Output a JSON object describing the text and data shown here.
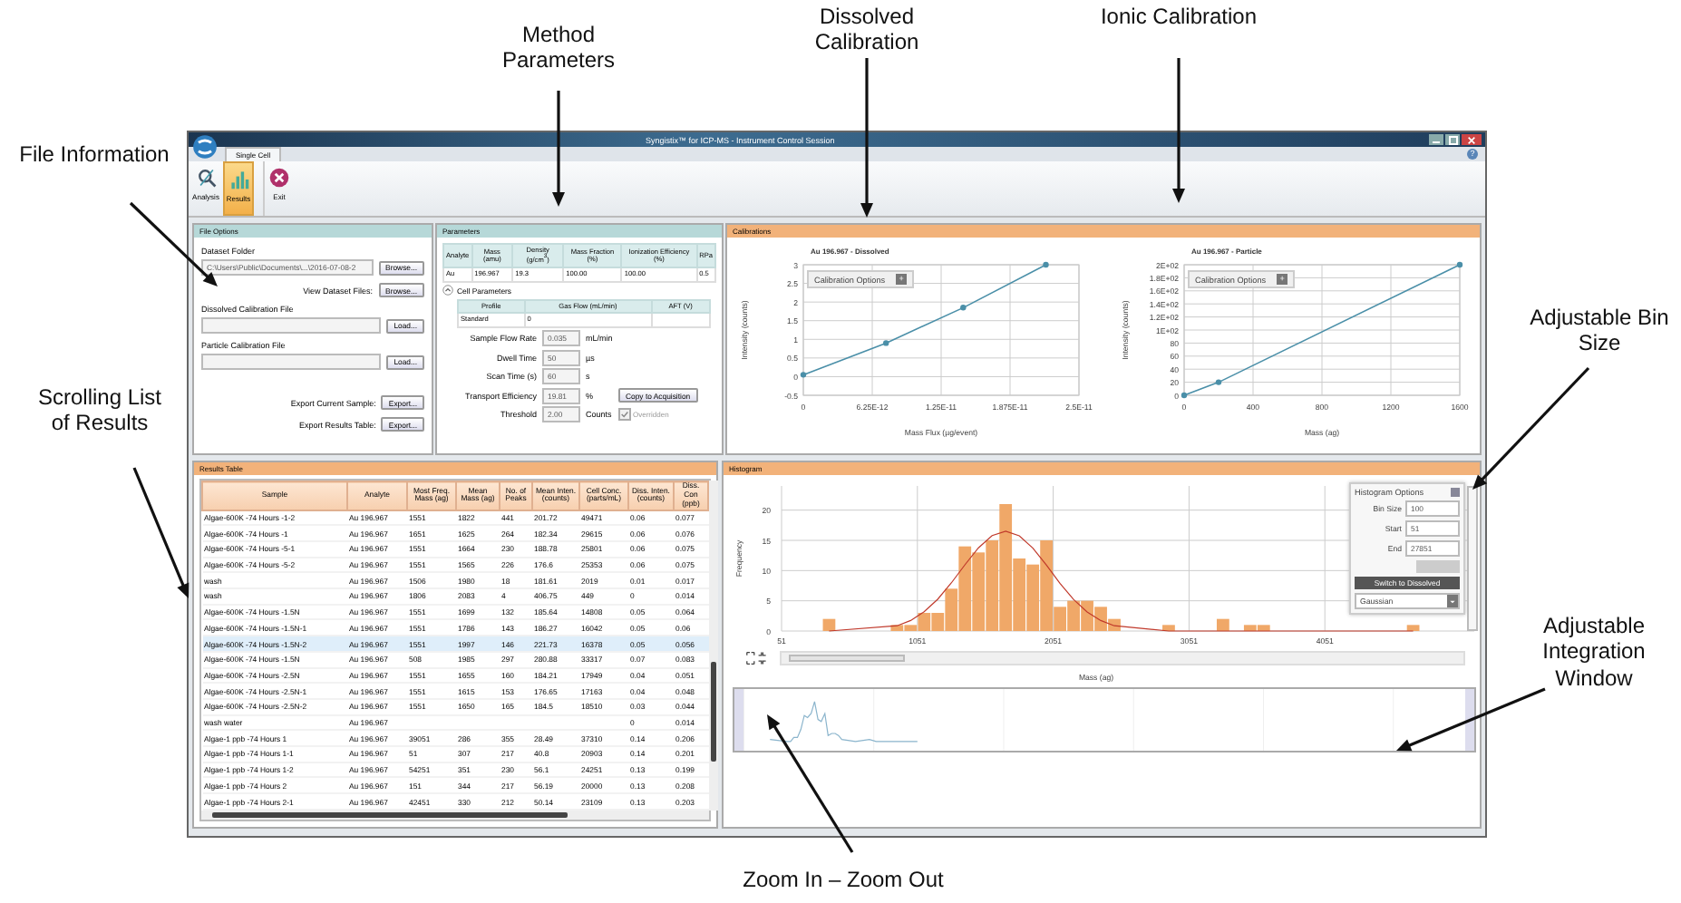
{
  "callouts": [
    {
      "text": "Method Parameters"
    },
    {
      "text": "Dissolved Calibration"
    },
    {
      "text": "Ionic Calibration"
    },
    {
      "text": "File Information"
    },
    {
      "text": "Scrolling List of Results"
    },
    {
      "text": "Adjustable Bin Size"
    },
    {
      "text": "Adjustable Integration Window"
    },
    {
      "text": "Zoom In – Zoom Out"
    }
  ],
  "window": {
    "title": "Syngistix™ for ICP-MS - Instrument Control Session",
    "help": "?"
  },
  "ribbon": {
    "tab": "Single Cell",
    "buttons": [
      {
        "label": "Analysis",
        "kind": "analysis",
        "selected": false
      },
      {
        "label": "Results",
        "kind": "results",
        "selected": true
      },
      {
        "label": "Exit",
        "kind": "exit",
        "selected": false
      }
    ]
  },
  "file_options": {
    "title": "File Options",
    "rows": [
      {
        "kind": "folder",
        "label": "Dataset Folder",
        "value": "C:\\Users\\Public\\Documents\\...\\2016-07-08-2",
        "button": "Browse..."
      },
      {
        "kind": "action",
        "label": "View Dataset Files:",
        "button": "Browse..."
      },
      {
        "kind": "file",
        "label": "Dissolved Calibration File",
        "button": "Load..."
      },
      {
        "kind": "file",
        "label": "Particle Calibration File",
        "button": "Load..."
      },
      {
        "kind": "action",
        "label": "Export Current Sample:",
        "button": "Export..."
      },
      {
        "kind": "action",
        "label": "Export Results Table:",
        "button": "Export..."
      }
    ]
  },
  "parameters": {
    "title": "Parameters",
    "analyte_table": {
      "columns": [
        "Analyte",
        "Mass (amu)",
        "Density (g/cm$^{3}$)",
        "Mass Fraction (%)",
        "Ionization Efficiency (%)",
        "RPa"
      ],
      "rows": [
        [
          "Au",
          "196.967",
          "19.3",
          "100.00",
          "100.00",
          "0.5"
        ]
      ]
    },
    "cell_parameters": {
      "label": "Cell Parameters",
      "expanded": true,
      "columns": [
        "Profile",
        "Gas Flow (mL/min)",
        "AFT (V)"
      ],
      "rows": [
        [
          "Standard",
          "0",
          null
        ]
      ]
    },
    "rows": [
      {
        "kind": "field",
        "label": "Sample Flow Rate",
        "value": "0.035",
        "unit": "mL/min"
      },
      {
        "kind": "field",
        "label": "Dwell Time",
        "value": "50",
        "unit": "µs"
      },
      {
        "kind": "field",
        "label": "Scan Time (s)",
        "value": "60",
        "unit": "s"
      },
      {
        "kind": "button",
        "label": "Transport Efficiency",
        "value": "19.81",
        "unit": "%",
        "button": "Copy to Acquisition"
      },
      {
        "kind": "checkbox",
        "label": "Threshold",
        "value": "2.00",
        "unit": "Counts",
        "checkbox": {
          "label": "Overridden",
          "checked": true
        }
      }
    ]
  },
  "calibrations": {
    "title": "Calibrations",
    "charts": [
      {
        "options_label": "Calibration Options",
        "options_button": "+",
        "chart_data": {
          "type": "line",
          "title": "Au 196.967 - Dissolved",
          "xlabel": "Mass Flux (µg/event)",
          "ylabel": "Intensity (counts)",
          "x": [
            0,
            7.5e-12,
            1.45e-11,
            2.2e-11
          ],
          "grid": true,
          "series": [
            {
              "color": "#4a8fa8",
              "marker": true,
              "values": [
                0.05,
                0.9,
                1.85,
                3
              ]
            }
          ],
          "xlim": [
            0,
            2.5e-11
          ],
          "ylim": [
            -0.5,
            3
          ],
          "xticks": [
            {
              "value": 0,
              "label": "0"
            },
            {
              "value": 6.25e-12,
              "label": "6.25E-12"
            },
            {
              "value": 1.25e-11,
              "label": "1.25E-11"
            },
            {
              "value": 1.875e-11,
              "label": "1.875E-11"
            },
            {
              "value": 2.5e-11,
              "label": "2.5E-11"
            }
          ],
          "yticks": [
            -0.5,
            0,
            0.5,
            1,
            1.5,
            2,
            2.5,
            3
          ]
        }
      },
      {
        "options_label": "Calibration Options",
        "options_button": "+",
        "chart_data": {
          "type": "line",
          "title": "Au 196.967 - Particle",
          "xlabel": "Mass (ag)",
          "ylabel": "Intensity (counts)",
          "x": [
            0,
            200,
            1600
          ],
          "grid": true,
          "series": [
            {
              "color": "#4a8fa8",
              "marker": true,
              "values": [
                0,
                20,
                200
              ]
            }
          ],
          "xlim": [
            0,
            1600
          ],
          "ylim": [
            0,
            200
          ],
          "xticks": [
            0,
            400,
            800,
            1200,
            1600
          ],
          "yticks": [
            0,
            20,
            40,
            60,
            80,
            {
              "value": 100,
              "label": "1E+02"
            },
            {
              "value": 120,
              "label": "1.2E+02"
            },
            {
              "value": 140,
              "label": "1.4E+02"
            },
            {
              "value": 160,
              "label": "1.6E+02"
            },
            {
              "value": 180,
              "label": "1.8E+02"
            },
            {
              "value": 200,
              "label": "2E+02"
            }
          ]
        }
      }
    ]
  },
  "results_table": {
    "title": "Results Table",
    "columns": [
      "Sample",
      "Analyte",
      "Most Freq. Mass (ag)",
      "Mean Mass (ag)",
      "No. of Peaks",
      "Mean Inten. (counts)",
      "Cell Conc. (parts/mL)",
      "Diss. Inten. (counts)",
      "Diss. Con (ppb)"
    ],
    "rows": [
      {
        "selected": false,
        "cells": [
          "Algae-600K -74 Hours -1-2",
          "Au 196.967",
          "1551",
          "1822",
          "441",
          "201.72",
          "49471",
          "0.06",
          "0.077"
        ]
      },
      {
        "selected": false,
        "cells": [
          "Algae-600K -74 Hours -1",
          "Au 196.967",
          "1651",
          "1625",
          "264",
          "182.34",
          "29615",
          "0.06",
          "0.076"
        ]
      },
      {
        "selected": false,
        "cells": [
          "Algae-600K -74 Hours -5-1",
          "Au 196.967",
          "1551",
          "1664",
          "230",
          "188.78",
          "25801",
          "0.06",
          "0.075"
        ]
      },
      {
        "selected": false,
        "cells": [
          "Algae-600K -74 Hours -5-2",
          "Au 196.967",
          "1551",
          "1565",
          "226",
          "176.6",
          "25353",
          "0.06",
          "0.075"
        ]
      },
      {
        "selected": false,
        "cells": [
          "wash",
          "Au 196.967",
          "1506",
          "1980",
          "18",
          "181.61",
          "2019",
          "0.01",
          "0.017"
        ]
      },
      {
        "selected": false,
        "cells": [
          "wash",
          "Au 196.967",
          "1806",
          "2083",
          "4",
          "406.75",
          "449",
          "0",
          "0.014"
        ]
      },
      {
        "selected": false,
        "cells": [
          "Algae-600K -74 Hours -1.5N",
          "Au 196.967",
          "1551",
          "1699",
          "132",
          "185.64",
          "14808",
          "0.05",
          "0.064"
        ]
      },
      {
        "selected": false,
        "cells": [
          "Algae-600K -74 Hours -1.5N-1",
          "Au 196.967",
          "1551",
          "1786",
          "143",
          "186.27",
          "16042",
          "0.05",
          "0.06"
        ]
      },
      {
        "selected": true,
        "cells": [
          "Algae-600K -74 Hours -1.5N-2",
          "Au 196.967",
          "1551",
          "1997",
          "146",
          "221.73",
          "16378",
          "0.05",
          "0.056"
        ]
      },
      {
        "selected": false,
        "cells": [
          "Algae-600K -74 Hours -1.5N",
          "Au 196.967",
          "508",
          "1985",
          "297",
          "280.88",
          "33317",
          "0.07",
          "0.083"
        ]
      },
      {
        "selected": false,
        "cells": [
          "Algae-600K -74 Hours -2.5N",
          "Au 196.967",
          "1551",
          "1655",
          "160",
          "184.21",
          "17949",
          "0.04",
          "0.051"
        ]
      },
      {
        "selected": false,
        "cells": [
          "Algae-600K -74 Hours -2.5N-1",
          "Au 196.967",
          "1551",
          "1615",
          "153",
          "176.65",
          "17163",
          "0.04",
          "0.048"
        ]
      },
      {
        "selected": false,
        "cells": [
          "Algae-600K -74 Hours -2.5N-2",
          "Au 196.967",
          "1551",
          "1650",
          "165",
          "184.5",
          "18510",
          "0.03",
          "0.044"
        ]
      },
      {
        "selected": false,
        "cells": [
          "wash water",
          "Au 196.967",
          null,
          null,
          null,
          null,
          null,
          "0",
          "0.014"
        ]
      },
      {
        "selected": false,
        "cells": [
          "Algae-1 ppb -74 Hours 1",
          "Au 196.967",
          "39051",
          "286",
          "355",
          "28.49",
          "37310",
          "0.14",
          "0.206"
        ]
      },
      {
        "selected": false,
        "cells": [
          "Algae-1 ppb -74 Hours 1-1",
          "Au 196.967",
          "51",
          "307",
          "217",
          "40.8",
          "20903",
          "0.14",
          "0.201"
        ]
      },
      {
        "selected": false,
        "cells": [
          "Algae-1 ppb -74 Hours 1-2",
          "Au 196.967",
          "54251",
          "351",
          "230",
          "56.1",
          "24251",
          "0.13",
          "0.199"
        ]
      },
      {
        "selected": false,
        "cells": [
          "Algae-1 ppb -74 Hours 2",
          "Au 196.967",
          "151",
          "344",
          "217",
          "56.19",
          "20000",
          "0.13",
          "0.208"
        ]
      },
      {
        "selected": false,
        "cells": [
          "Algae-1 ppb -74 Hours 2-1",
          "Au 196.967",
          "42451",
          "330",
          "212",
          "50.14",
          "23109",
          "0.13",
          "0.203"
        ]
      }
    ]
  },
  "histogram": {
    "title": "Histogram",
    "chart_data": {
      "type": "bar",
      "xlabel": "Mass (ag)",
      "ylabel": "Frequency",
      "x": [
        401,
        901,
        1001,
        1101,
        1201,
        1301,
        1401,
        1501,
        1601,
        1701,
        1801,
        1901,
        2001,
        2101,
        2201,
        2301,
        2401,
        2501,
        2901,
        3301,
        3501,
        3601,
        4701
      ],
      "grid": true,
      "series": [
        {
          "type": "bar",
          "color": "#f0a868",
          "values": [
            2,
            1,
            1,
            3,
            3,
            7,
            14,
            13,
            15,
            21,
            12,
            11,
            15,
            4,
            5,
            5,
            4,
            2,
            1,
            2,
            1,
            1,
            1
          ]
        },
        {
          "type": "line",
          "color": "#c0392b",
          "values": [
            0.01,
            0.88,
            1.75,
            3.18,
            5.26,
            7.94,
            10.94,
            13.76,
            15.77,
            16.5,
            15.74,
            13.71,
            10.89,
            7.89,
            5.21,
            3.14,
            1.73,
            0.87,
            0.01,
            0,
            0,
            0,
            0
          ]
        }
      ],
      "xlim": [
        51,
        5151
      ],
      "ylim": [
        0,
        24
      ],
      "xticks": [
        51,
        1051,
        2051,
        3051,
        4051
      ],
      "yticks": [
        0,
        5,
        10,
        15,
        20
      ]
    },
    "options": {
      "title": "Histogram Options",
      "fields": [
        {
          "label": "Bin Size",
          "value": "100"
        },
        {
          "label": "Start",
          "value": "51"
        },
        {
          "label": "End",
          "value": "27851"
        }
      ],
      "switch_button": "Switch to Dissolved",
      "fit": "Gaussian"
    }
  }
}
